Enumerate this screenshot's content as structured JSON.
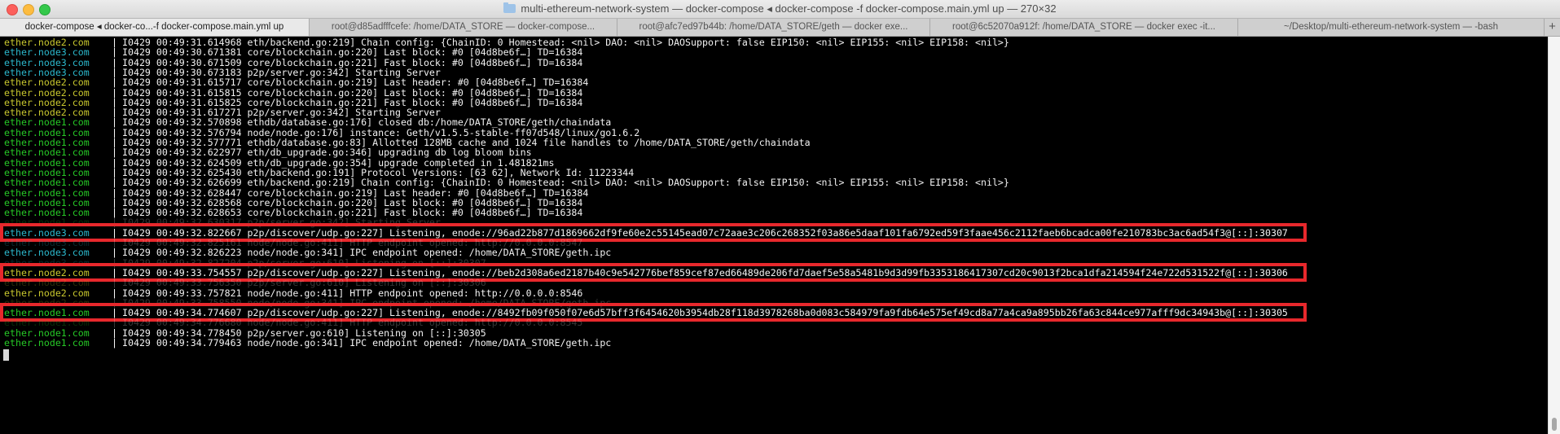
{
  "window": {
    "title": "multi-ethereum-network-system — docker-compose ◂ docker-compose -f docker-compose.main.yml up — 270×32"
  },
  "tabs": [
    {
      "label": "docker-compose ◂ docker-co...-f docker-compose.main.yml up",
      "active": true
    },
    {
      "label": "root@d85adfffcefe: /home/DATA_STORE — docker-compose...",
      "active": false
    },
    {
      "label": "root@afc7ed97b44b: /home/DATA_STORE/geth — docker exe...",
      "active": false
    },
    {
      "label": "root@6c52070a912f: /home/DATA_STORE — docker exec -it...",
      "active": false
    },
    {
      "label": "~/Desktop/multi-ethereum-network-system — -bash",
      "active": false
    }
  ],
  "add_tab_label": "+",
  "colors": {
    "node1": "#26c926",
    "node2": "#c9c82e",
    "node3": "#2bb8cc",
    "highlight": "#e8282c"
  },
  "separator": "|",
  "lines": [
    {
      "host": "ether.node2.com",
      "msg": "I0429 00:49:31.614968 eth/backend.go:219] Chain config: {ChainID: 0 Homestead: <nil> DAO: <nil> DAOSupport: false EIP150: <nil> EIP155: <nil> EIP158: <nil>}"
    },
    {
      "host": "ether.node3.com",
      "msg": "I0429 00:49:30.671381 core/blockchain.go:220] Last block: #0 [04d8be6f…] TD=16384"
    },
    {
      "host": "ether.node3.com",
      "msg": "I0429 00:49:30.671509 core/blockchain.go:221] Fast block: #0 [04d8be6f…] TD=16384"
    },
    {
      "host": "ether.node3.com",
      "msg": "I0429 00:49:30.673183 p2p/server.go:342] Starting Server"
    },
    {
      "host": "ether.node2.com",
      "msg": "I0429 00:49:31.615717 core/blockchain.go:219] Last header: #0 [04d8be6f…] TD=16384"
    },
    {
      "host": "ether.node2.com",
      "msg": "I0429 00:49:31.615815 core/blockchain.go:220] Last block: #0 [04d8be6f…] TD=16384"
    },
    {
      "host": "ether.node2.com",
      "msg": "I0429 00:49:31.615825 core/blockchain.go:221] Fast block: #0 [04d8be6f…] TD=16384"
    },
    {
      "host": "ether.node2.com",
      "msg": "I0429 00:49:31.617271 p2p/server.go:342] Starting Server"
    },
    {
      "host": "ether.node1.com",
      "msg": "I0429 00:49:32.570898 ethdb/database.go:176] closed db:/home/DATA_STORE/geth/chaindata"
    },
    {
      "host": "ether.node1.com",
      "msg": "I0429 00:49:32.576794 node/node.go:176] instance: Geth/v1.5.5-stable-ff07d548/linux/go1.6.2"
    },
    {
      "host": "ether.node1.com",
      "msg": "I0429 00:49:32.577771 ethdb/database.go:83] Allotted 128MB cache and 1024 file handles to /home/DATA_STORE/geth/chaindata"
    },
    {
      "host": "ether.node1.com",
      "msg": "I0429 00:49:32.622977 eth/db_upgrade.go:346] upgrading db log bloom bins"
    },
    {
      "host": "ether.node1.com",
      "msg": "I0429 00:49:32.624509 eth/db_upgrade.go:354] upgrade completed in 1.481821ms"
    },
    {
      "host": "ether.node1.com",
      "msg": "I0429 00:49:32.625430 eth/backend.go:191] Protocol Versions: [63 62], Network Id: 11223344"
    },
    {
      "host": "ether.node1.com",
      "msg": "I0429 00:49:32.626699 eth/backend.go:219] Chain config: {ChainID: 0 Homestead: <nil> DAO: <nil> DAOSupport: false EIP150: <nil> EIP155: <nil> EIP158: <nil>}"
    },
    {
      "host": "ether.node1.com",
      "msg": "I0429 00:49:32.628447 core/blockchain.go:219] Last header: #0 [04d8be6f…] TD=16384"
    },
    {
      "host": "ether.node1.com",
      "msg": "I0429 00:49:32.628568 core/blockchain.go:220] Last block: #0 [04d8be6f…] TD=16384"
    },
    {
      "host": "ether.node1.com",
      "msg": "I0429 00:49:32.628653 core/blockchain.go:221] Fast block: #0 [04d8be6f…] TD=16384"
    },
    {
      "host": "ether.node1.com",
      "msg": "I0429 00:49:32.630317 p2p/server.go:342] Starting Server",
      "ghost": true
    },
    {
      "host": "ether.node3.com",
      "msg": "I0429 00:49:32.822667 p2p/discover/udp.go:227] Listening, enode://96ad22b877d1869662df9fe60e2c55145ead07c72aae3c206c268352f03a86e5daaf101fa6792ed59f3faae456c2112faeb6bcadca00fe210783bc3ac6ad54f3@[::]:30307",
      "highlight": true
    },
    {
      "host": "ether.node3.com",
      "msg": "I0429 00:49:32.825161 node/node.go:411] HTTP endpoint opened: http://0.0.0.0:8547",
      "ghost": true
    },
    {
      "host": "ether.node3.com",
      "msg": "I0429 00:49:32.826223 node/node.go:341] IPC endpoint opened: /home/DATA_STORE/geth.ipc"
    },
    {
      "host": "ether.node3.com",
      "msg": "I0429 00:49:32.827204 p2p/server.go:610] Listening on [::]:30307",
      "ghost": true
    },
    {
      "host": "ether.node2.com",
      "msg": "I0429 00:49:33.754557 p2p/discover/udp.go:227] Listening, enode://beb2d308a6ed2187b40c9e542776bef859cef87ed66489de206fd7daef5e58a5481b9d3d99fb3353186417307cd20c9013f2bca1dfa214594f24e722d531522f@[::]:30306",
      "highlight": true
    },
    {
      "host": "ether.node2.com",
      "msg": "I0429 00:49:33.756350 p2p/server.go:610] Listening on [::]:30306",
      "ghost": true
    },
    {
      "host": "ether.node2.com",
      "msg": "I0429 00:49:33.757821 node/node.go:411] HTTP endpoint opened: http://0.0.0.0:8546"
    },
    {
      "host": "ether.node2.com",
      "msg": "I0429 00:49:33.758550 node/node.go:341] IPC endpoint opened: /home/DATA_STORE/geth.ipc",
      "ghost": true
    },
    {
      "host": "ether.node1.com",
      "msg": "I0429 00:49:34.774607 p2p/discover/udp.go:227] Listening, enode://8492fb09f050f07e6d57bff3f6454620b3954db28f118d3978268ba0d083c584979fa9fdb64e575ef49cd8a77a4ca9a895bb26fa63c844ce977afff9dc34943b@[::]:30305",
      "highlight": true
    },
    {
      "host": "ether.node1.com",
      "msg": "I0429 00:49:34.776680 node/node.go:411] HTTP endpoint opened: http://0.0.0.0:8545",
      "ghost": true
    },
    {
      "host": "ether.node1.com",
      "msg": "I0429 00:49:34.778450 p2p/server.go:610] Listening on [::]:30305"
    },
    {
      "host": "ether.node1.com",
      "msg": "I0429 00:49:34.779463 node/node.go:341] IPC endpoint opened: /home/DATA_STORE/geth.ipc"
    }
  ]
}
